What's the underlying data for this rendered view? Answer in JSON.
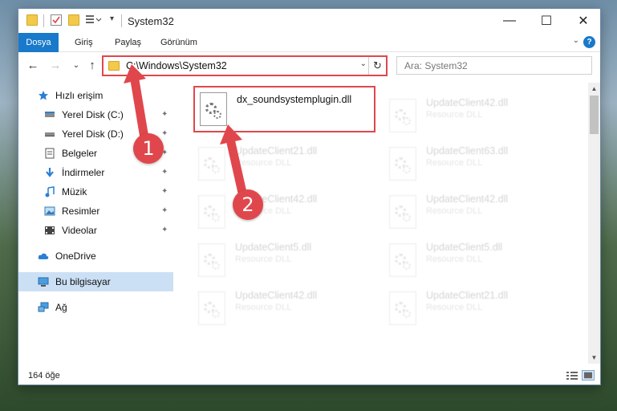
{
  "window": {
    "title": "System32",
    "min_glyph": "—",
    "max_glyph": "☐",
    "close_glyph": "✕"
  },
  "ribbon": {
    "tabs": [
      "Dosya",
      "Giriş",
      "Paylaş",
      "Görünüm"
    ],
    "help_glyph": "?",
    "expand_glyph": "⌄"
  },
  "nav": {
    "back_glyph": "←",
    "forward_glyph": "→",
    "recent_glyph": "⌄",
    "up_glyph": "↑",
    "address": "C:\\Windows\\System32",
    "address_drop": "⌄",
    "refresh_glyph": "↻",
    "search_placeholder": "Ara: System32"
  },
  "sidebar": {
    "items": [
      {
        "label": "Hızlı erişim",
        "icon": "star-icon",
        "pinned": false
      },
      {
        "label": "Yerel Disk (C:)",
        "icon": "drive-icon",
        "pinned": true
      },
      {
        "label": "Yerel Disk (D:)",
        "icon": "drive-icon",
        "pinned": true
      },
      {
        "label": "Belgeler",
        "icon": "documents-icon",
        "pinned": true
      },
      {
        "label": "İndirmeler",
        "icon": "download-icon",
        "pinned": true
      },
      {
        "label": "Müzik",
        "icon": "music-icon",
        "pinned": true
      },
      {
        "label": "Resimler",
        "icon": "pictures-icon",
        "pinned": true
      },
      {
        "label": "Videolar",
        "icon": "video-icon",
        "pinned": true
      },
      {
        "label": "OneDrive",
        "icon": "cloud-icon",
        "pinned": false
      },
      {
        "label": "Bu bilgisayar",
        "icon": "computer-icon",
        "pinned": false,
        "selected": true
      },
      {
        "label": "Ağ",
        "icon": "network-icon",
        "pinned": false
      }
    ],
    "pin_glyph": "📌"
  },
  "files": [
    {
      "name": "dx_soundsystemplugin.dll",
      "type": "",
      "faded": false
    },
    {
      "name": "UpdateClient42.dll",
      "type": "Resource DLL",
      "faded": true
    },
    {
      "name": "UpdateClient21.dll",
      "type": "Resource DLL",
      "faded": true
    },
    {
      "name": "UpdateClient63.dll",
      "type": "Resource DLL",
      "faded": true
    },
    {
      "name": "UpdateClient42.dll",
      "type": "Resource DLL",
      "faded": true
    },
    {
      "name": "UpdateClient42.dll",
      "type": "Resource DLL",
      "faded": true
    },
    {
      "name": "UpdateClient5.dll",
      "type": "Resource DLL",
      "faded": true
    },
    {
      "name": "UpdateClient5.dll",
      "type": "Resource DLL",
      "faded": true
    },
    {
      "name": "UpdateClient42.dll",
      "type": "Resource DLL",
      "faded": true
    },
    {
      "name": "UpdateClient21.dll",
      "type": "Resource DLL",
      "faded": true
    }
  ],
  "status": {
    "count": "164 öğe"
  },
  "annotations": {
    "marker1": "1",
    "marker2": "2",
    "color": "#e0474c"
  },
  "colors": {
    "accent": "#1979ca",
    "selection": "#cce0f5",
    "highlight": "#e0474c"
  }
}
